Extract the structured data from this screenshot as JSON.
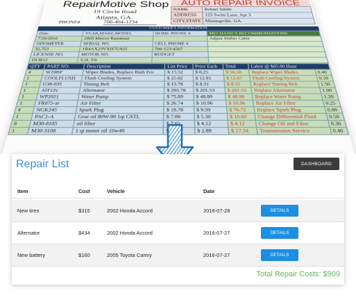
{
  "invoice": {
    "shop_name": "RepairMotive Shop",
    "address_line1": "19 Circle Road",
    "address_line2": "Atlanta, GA.",
    "phone_label": "PHONE#",
    "phone": "706-404-1234",
    "title": "AUTO REPAIR INVOICE",
    "customer": [
      {
        "key": "NAME",
        "value": "Robert Smith"
      },
      {
        "key": "ADDRESS",
        "value": "125 Swim Lane, Apt 3"
      },
      {
        "key": "CITY,STATE",
        "value": "Missingville, GA."
      }
    ],
    "band_customer": "CUSTOMER'S INFORMATION",
    "vehicle_headers": [
      "Date",
      "YEAR,MAKE,MODEL",
      "HOME PHONE #",
      "MECHANICS RECOMMENDATIONS"
    ],
    "vehicle_row": [
      "7/26/2016",
      "2005 Mercer Runabout",
      "",
      "Adjust Shifter Cable"
    ],
    "odometer_headers": [
      "ODOMETER",
      "SERIAL NO.",
      "CELL PHONE #"
    ],
    "odometer_row": [
      "32,753",
      "1B4AX23VXH7U925",
      "706-123-4567"
    ],
    "license_headers": [
      "LICENSE NO.",
      "MOTOR NO.",
      "BUDGET"
    ],
    "license_row": [
      "DUB12",
      "3.2L V8",
      ""
    ],
    "parts_headers": [
      "QTY",
      "PART NO.",
      "Description",
      "List Price",
      "Price Each",
      "Total",
      "Labor @ $65.00 Hour"
    ],
    "parts": [
      [
        "4",
        "W19RP",
        "Wiper Blades, Replace Both Fro",
        "$ 15.52",
        "$ 8.25",
        "$ 16.50",
        "Replace Wiper Blades",
        "0.40"
      ],
      [
        "1",
        "COOLFLUSH",
        "Flush Cooling System",
        "$ 25.82",
        "$ 12.91",
        "$ 12.67",
        "Flush Cooling System",
        "0.50"
      ],
      [
        "1",
        "G38-035",
        "Timing Belt",
        "$ 13.78",
        "$ 8.31",
        "$ 8.31",
        "Replace Timing Belt",
        "1.50"
      ],
      [
        "1",
        "AlT12v",
        "Alternator",
        "$ 295.78",
        "$ 201.53",
        "$ 201.53",
        "Replace Alternator",
        "1.00"
      ],
      [
        "1",
        "WP2021",
        "Water Pump",
        "$ 75.89",
        "$ 48.99",
        "$ 48.99",
        "Replace Water Pump",
        "1.20"
      ],
      [
        "1",
        "FR875-ar",
        "Air Filter",
        "$ 26.74",
        "$ 10.96",
        "$ 10.96",
        "Replace Air Filter",
        "0.25"
      ],
      [
        "4",
        "NGK245",
        "Spark Plug",
        "$ 18.78",
        "$ 9.59",
        "$ 76.72",
        "Replace Spark Plug",
        "0.80"
      ],
      [
        "1",
        "PAC1-A",
        "Gear oil 80W-90 1qt CSTL",
        "$ 7.86",
        "$ 5.30",
        "$ 10.60",
        "Change Differential Fluid",
        "0.50"
      ],
      [
        "6",
        "M30-8105",
        "oil filter",
        "$ 7.61",
        "$ 4.12",
        "$ 4.12",
        "Change Oil and Filter",
        "0.30"
      ],
      [
        "1",
        "M30-3108",
        "1 qt motor oil 10w40",
        "$ 3.49",
        "$ 2.89",
        "$ 17.34",
        "Transmission Service",
        "0.40"
      ]
    ]
  },
  "repair_list": {
    "title": "Repair List",
    "dashboard_label": "DASHBOARD",
    "columns": [
      "Item",
      "Cost",
      "Vehicle",
      "Date"
    ],
    "rows": [
      {
        "item": "New tires",
        "cost": "$315",
        "vehicle": "2002 Honda Accord",
        "date": "2016-07-28",
        "action": "DETAILS"
      },
      {
        "item": "Alternator",
        "cost": "$434",
        "vehicle": "2002 Honda Accord",
        "date": "2016-07-27",
        "action": "DETAILS"
      },
      {
        "item": "New battery",
        "cost": "$160",
        "vehicle": "2005 Toyota Camry",
        "date": "2016-07-27",
        "action": "DETAILS"
      }
    ],
    "total_text": "Total Repair Costs: $909"
  },
  "colors": {
    "accent": "#3b8fd8",
    "details_button": "#1c8ee3",
    "dashboard_button": "#3c3c3c",
    "total_text": "#5cb85c",
    "invoice_title": "#c0392b",
    "arrow": "#2f8fd6"
  },
  "icons": {
    "arrow": "down-arrow-icon"
  }
}
